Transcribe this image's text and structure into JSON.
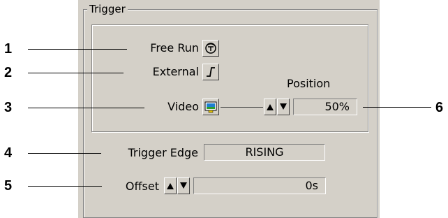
{
  "group": {
    "title": "Trigger"
  },
  "mode": {
    "free_run_label": "Free Run",
    "external_label": "External",
    "video_label": "Video"
  },
  "position": {
    "label": "Position",
    "value": "50%"
  },
  "edge": {
    "label": "Trigger Edge",
    "value": "RISING"
  },
  "offset": {
    "label": "Offset",
    "value": "0s"
  },
  "callouts": [
    "1",
    "2",
    "3",
    "4",
    "5",
    "6"
  ],
  "icons": {
    "free_run": "free-run-icon",
    "external": "external-edge-icon",
    "video": "video-monitor-icon",
    "up": "arrow-up-icon",
    "down": "arrow-down-icon"
  }
}
